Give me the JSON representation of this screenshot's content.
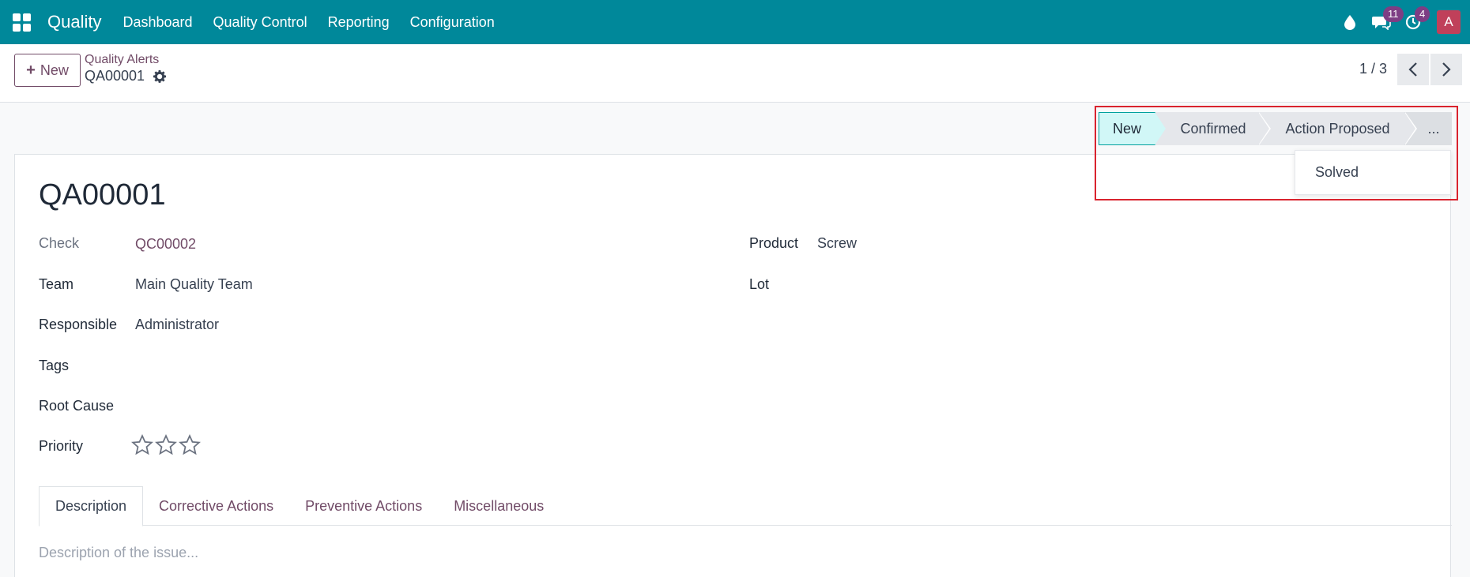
{
  "navbar": {
    "app_name": "Quality",
    "menu": [
      "Dashboard",
      "Quality Control",
      "Reporting",
      "Configuration"
    ],
    "messages_count": "11",
    "activities_count": "4",
    "avatar_letter": "A",
    "bg_color": "#00889a"
  },
  "control_panel": {
    "new_label": "New",
    "breadcrumb": "Quality Alerts",
    "record": "QA00001",
    "pager": "1 / 3"
  },
  "statusbar": {
    "stages": [
      "New",
      "Confirmed",
      "Action Proposed",
      "..."
    ],
    "active": "New",
    "dropdown_item": "Solved"
  },
  "form": {
    "title": "QA00001",
    "check_label": "Check",
    "check_value": "QC00002",
    "team_label": "Team",
    "team_value": "Main Quality Team",
    "responsible_label": "Responsible",
    "responsible_value": "Administrator",
    "tags_label": "Tags",
    "root_cause_label": "Root Cause",
    "priority_label": "Priority",
    "priority_stars": 0,
    "priority_max": 3,
    "product_label": "Product",
    "product_value": "Screw",
    "lot_label": "Lot"
  },
  "tabs": [
    "Description",
    "Corrective Actions",
    "Preventive Actions",
    "Miscellaneous"
  ],
  "description_placeholder": "Description of the issue..."
}
